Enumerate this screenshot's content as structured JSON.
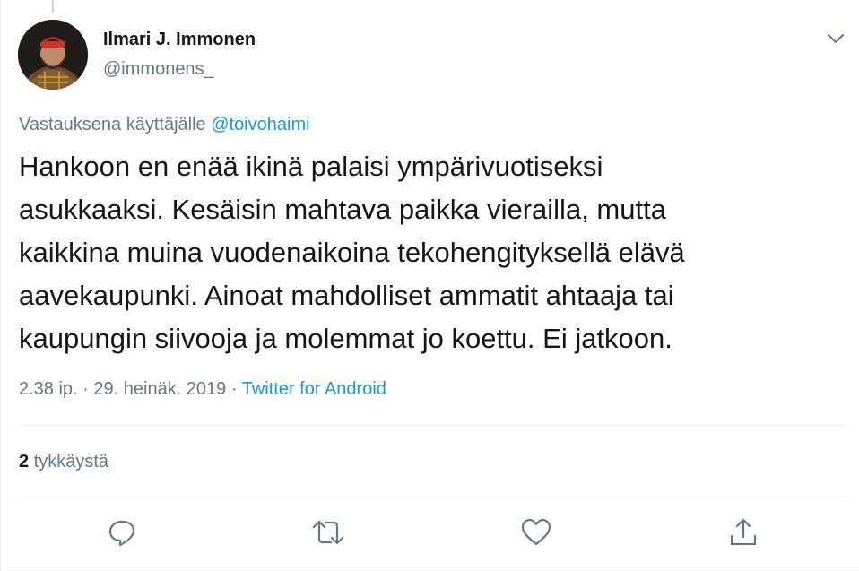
{
  "author": {
    "name": "Ilmari J. Immonen",
    "handle": "@immonens_"
  },
  "reply": {
    "prefix": "Vastauksena käyttäjälle ",
    "mention": "@toivohaimi"
  },
  "tweet": {
    "line1": "Hankoon en enää ikinä palaisi ympärivuotiseksi",
    "line2": "asukkaaksi. Kesäisin mahtava paikka vierailla, mutta",
    "line3": "kaikkina muina vuodenaikoina tekohengityksellä elävä",
    "line4": "aavekaupunki. Ainoat mahdolliset ammatit ahtaaja tai",
    "line5": "kaupungin siivooja ja molemmat jo koettu. Ei jatkoon."
  },
  "meta": {
    "time": "2.38 ip.",
    "separator": " · ",
    "date": "29. heinäk. 2019",
    "source": "Twitter for Android"
  },
  "stats": {
    "likes_count": "2",
    "likes_label": " tykkäystä"
  },
  "icons": {
    "menu": "chevron-down-icon",
    "reply": "reply-icon",
    "retweet": "retweet-icon",
    "like": "heart-icon",
    "share": "share-icon"
  },
  "colors": {
    "text": "#14171a",
    "secondary": "#657786",
    "link": "#1b95e0",
    "border": "#e6ecf0"
  }
}
